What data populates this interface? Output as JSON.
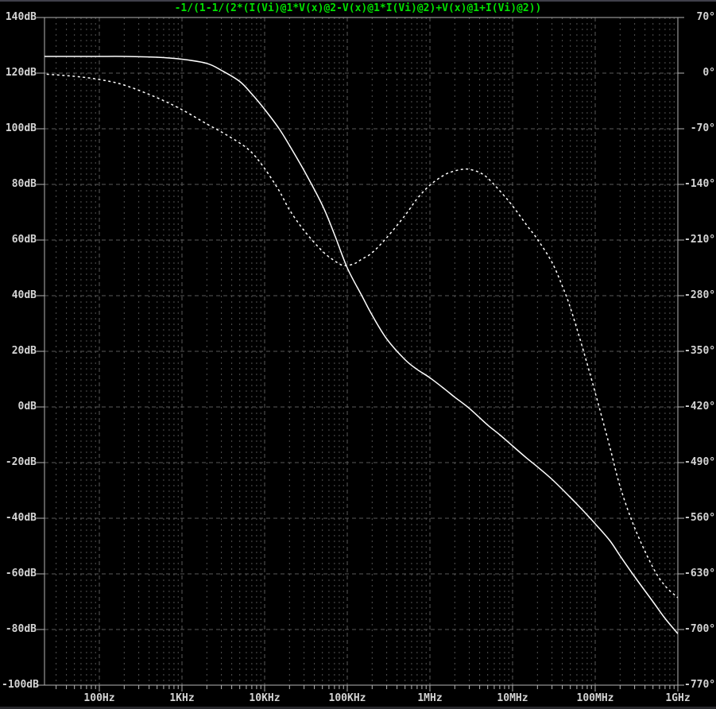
{
  "title": {
    "text": "-1/(1-1/(2*(I(Vi)@1*V(x)@2-V(x)@1*I(Vi)@2)+V(x)@1+I(Vi)@2))",
    "color": "#00e000"
  },
  "colors": {
    "background": "#000000",
    "axis": "#b4b4b4",
    "grid_major": "#5a5a5a",
    "grid_minor": "#525252",
    "labels": "#d4d4d4",
    "trace": "#ffffff"
  },
  "axes": {
    "left": {
      "unit": "dB",
      "labels": [
        "140dB",
        "120dB",
        "100dB",
        "80dB",
        "60dB",
        "40dB",
        "20dB",
        "0dB",
        "-20dB",
        "-40dB",
        "-60dB",
        "-80dB",
        "-100dB"
      ],
      "values": [
        140,
        120,
        100,
        80,
        60,
        40,
        20,
        0,
        -20,
        -40,
        -60,
        -80,
        -100
      ]
    },
    "right": {
      "unit": "deg",
      "labels": [
        "70°",
        "0°",
        "-70°",
        "-140°",
        "-210°",
        "-280°",
        "-350°",
        "-420°",
        "-490°",
        "-560°",
        "-630°",
        "-700°",
        "-770°"
      ],
      "values": [
        70,
        0,
        -70,
        -140,
        -210,
        -280,
        -350,
        -420,
        -490,
        -560,
        -630,
        -700,
        -770
      ]
    },
    "bottom": {
      "labels": [
        "100Hz",
        "1KHz",
        "10KHz",
        "100KHz",
        "1MHz",
        "10MHz",
        "100MHz",
        "1GHz"
      ],
      "values": [
        100,
        1000,
        10000,
        100000,
        1000000,
        10000000,
        100000000,
        1000000000
      ]
    }
  },
  "chart_data": {
    "type": "line",
    "title": "-1/(1-1/(2*(I(Vi)@1*V(x)@2-V(x)@1*I(Vi)@2)+V(x)@1+I(Vi)@2))",
    "x_axis": {
      "scale": "log",
      "min_hz": 20,
      "max_hz": 1000000000,
      "unit": "Hz",
      "grid": true
    },
    "y_left_axis": {
      "label": "magnitude",
      "unit": "dB",
      "min": -100,
      "max": 140,
      "step": 20
    },
    "y_right_axis": {
      "label": "phase",
      "unit": "deg",
      "min": -770,
      "max": 70,
      "step": 70
    },
    "legend_position": "none",
    "series": [
      {
        "name": "magnitude_dB",
        "axis": "left",
        "style": "solid",
        "color": "#ffffff",
        "points": [
          [
            20,
            126
          ],
          [
            50,
            126
          ],
          [
            100,
            126
          ],
          [
            200,
            126
          ],
          [
            500,
            125.7
          ],
          [
            1000,
            125
          ],
          [
            2000,
            123.5
          ],
          [
            3000,
            121
          ],
          [
            5000,
            117
          ],
          [
            7000,
            112.5
          ],
          [
            10000,
            107
          ],
          [
            15000,
            100
          ],
          [
            20000,
            94
          ],
          [
            30000,
            85
          ],
          [
            50000,
            72.5
          ],
          [
            70000,
            62
          ],
          [
            100000,
            50
          ],
          [
            150000,
            40
          ],
          [
            200000,
            33
          ],
          [
            300000,
            24.5
          ],
          [
            500000,
            17
          ],
          [
            700000,
            13.5
          ],
          [
            1000000,
            10.5
          ],
          [
            1500000,
            6.5
          ],
          [
            2000000,
            3.5
          ],
          [
            3000000,
            -0.5
          ],
          [
            5000000,
            -6.5
          ],
          [
            7000000,
            -10
          ],
          [
            10000000,
            -14
          ],
          [
            15000000,
            -18.5
          ],
          [
            20000000,
            -21.5
          ],
          [
            30000000,
            -26
          ],
          [
            50000000,
            -32.5
          ],
          [
            70000000,
            -37
          ],
          [
            100000000,
            -42
          ],
          [
            150000000,
            -48
          ],
          [
            200000000,
            -53.5
          ],
          [
            300000000,
            -61
          ],
          [
            500000000,
            -70
          ],
          [
            700000000,
            -76
          ],
          [
            1000000000,
            -81.5
          ]
        ]
      },
      {
        "name": "phase_deg",
        "axis": "right",
        "style": "dotted",
        "color": "#ffffff",
        "points": [
          [
            20,
            -1
          ],
          [
            50,
            -4
          ],
          [
            100,
            -8
          ],
          [
            200,
            -15
          ],
          [
            500,
            -31
          ],
          [
            1000,
            -46
          ],
          [
            2000,
            -64
          ],
          [
            3000,
            -74
          ],
          [
            5000,
            -88
          ],
          [
            7000,
            -100
          ],
          [
            10000,
            -120
          ],
          [
            15000,
            -148
          ],
          [
            20000,
            -172
          ],
          [
            30000,
            -198
          ],
          [
            50000,
            -224
          ],
          [
            70000,
            -236
          ],
          [
            90000,
            -242
          ],
          [
            120000,
            -240
          ],
          [
            150000,
            -234
          ],
          [
            200000,
            -226
          ],
          [
            300000,
            -207
          ],
          [
            500000,
            -179
          ],
          [
            700000,
            -158
          ],
          [
            1000000,
            -141
          ],
          [
            1500000,
            -128
          ],
          [
            2000000,
            -123
          ],
          [
            2500000,
            -121
          ],
          [
            3000000,
            -121
          ],
          [
            4000000,
            -125
          ],
          [
            5000000,
            -132
          ],
          [
            7000000,
            -148
          ],
          [
            10000000,
            -167
          ],
          [
            15000000,
            -192
          ],
          [
            20000000,
            -209
          ],
          [
            30000000,
            -238
          ],
          [
            40000000,
            -268
          ],
          [
            50000000,
            -295
          ],
          [
            70000000,
            -345
          ],
          [
            100000000,
            -402
          ],
          [
            150000000,
            -470
          ],
          [
            200000000,
            -520
          ],
          [
            300000000,
            -572
          ],
          [
            500000000,
            -622
          ],
          [
            700000000,
            -645
          ],
          [
            1000000000,
            -660
          ]
        ]
      }
    ]
  }
}
